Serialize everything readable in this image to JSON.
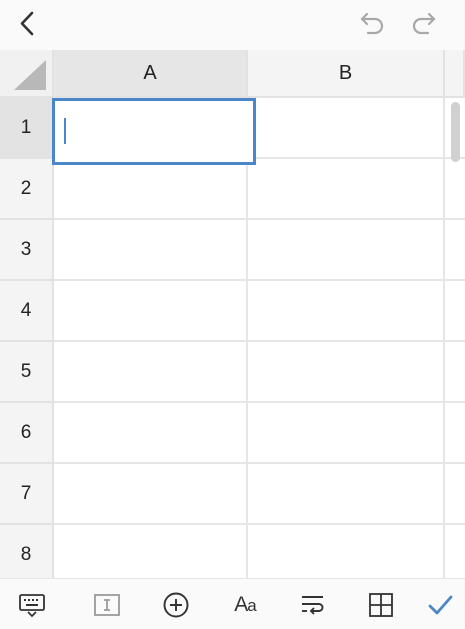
{
  "topbar": {
    "back_icon": "chevron-left-icon",
    "undo_icon": "undo-icon",
    "redo_icon": "redo-icon"
  },
  "sheet": {
    "columns": [
      "A",
      "B"
    ],
    "selected_column": "A",
    "rows": [
      "1",
      "2",
      "3",
      "4",
      "5",
      "6",
      "7",
      "8"
    ],
    "selected_row": "1",
    "active_cell": {
      "ref": "A1",
      "value": ""
    },
    "accent_color": "#4a86c8"
  },
  "toolbar": {
    "icons": [
      "keyboard-icon",
      "text-cursor-icon",
      "insert-icon",
      "font-style-icon",
      "wrap-text-icon",
      "borders-icon",
      "confirm-check-icon"
    ],
    "font_label_big": "A",
    "font_label_small": "a"
  }
}
